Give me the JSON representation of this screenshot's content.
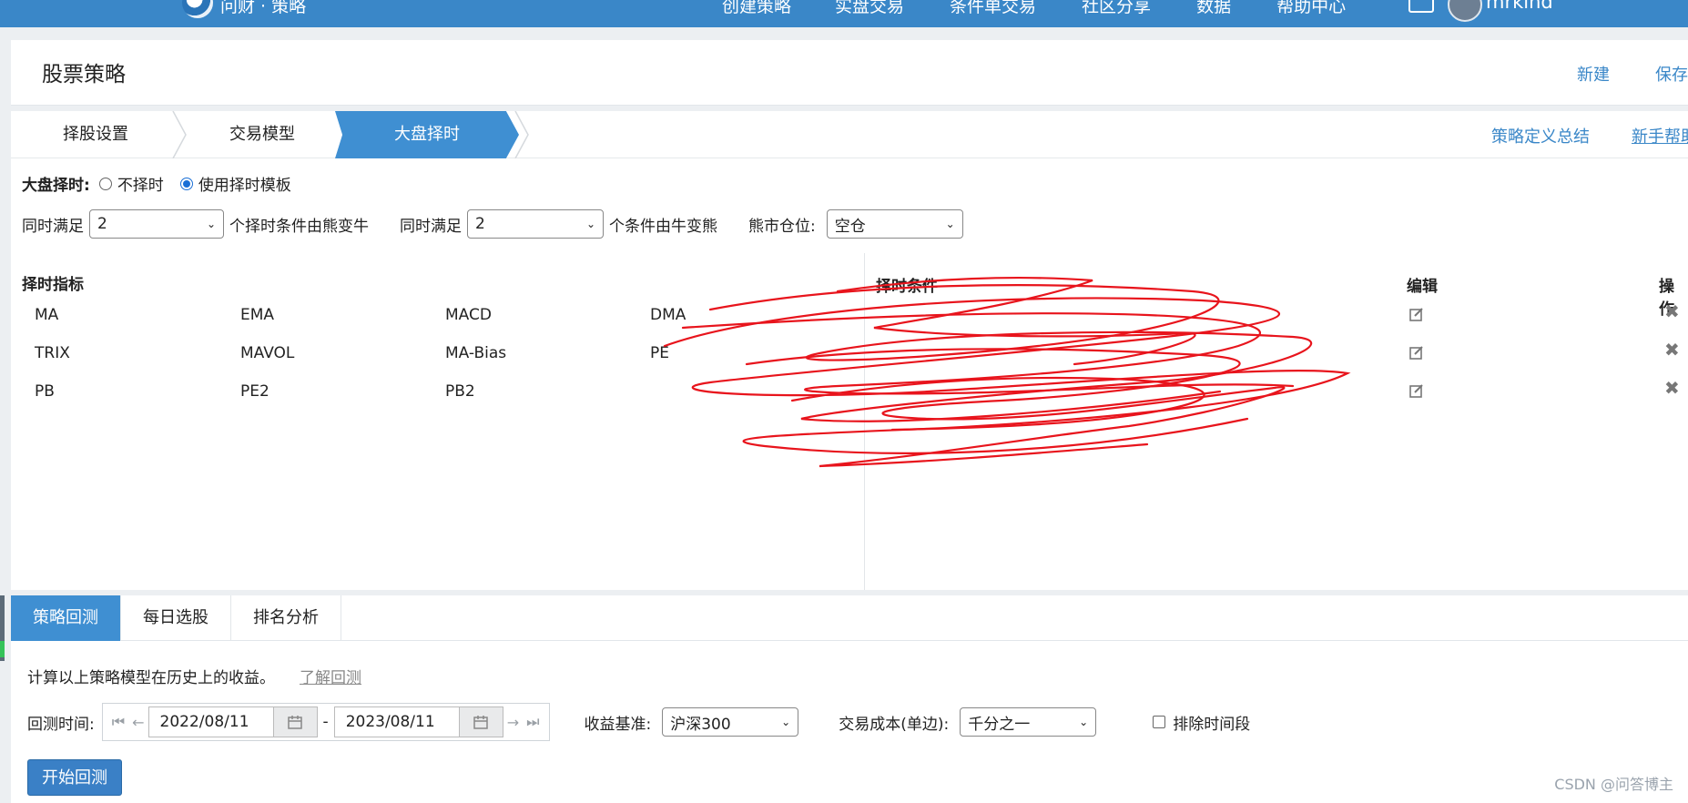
{
  "topnav": {
    "logo_text": "问财 · 策略",
    "items": [
      "创建策略",
      "实盘交易",
      "条件单交易",
      "社区分享",
      "数据",
      "帮助中心"
    ],
    "username": "mrkind"
  },
  "header": {
    "title": "股票策略",
    "new_label": "新建",
    "save_label": "保存"
  },
  "steps": {
    "items": [
      "择股设置",
      "交易模型",
      "大盘择时"
    ],
    "active": "大盘择时",
    "summary_link": "策略定义总结",
    "help_link": "新手帮助"
  },
  "market_timing": {
    "label": "大盘择时:",
    "option_none": "不择时",
    "option_template": "使用择时模板",
    "selected": "使用择时模板"
  },
  "conditions": {
    "prefix1": "同时满足",
    "value1": "2",
    "suffix1": "个择时条件由熊变牛",
    "prefix2": "同时满足",
    "value2": "2",
    "suffix2": "个条件由牛变熊",
    "position_label": "熊市仓位:",
    "position_value": "空仓"
  },
  "indicators": {
    "title": "择时指标",
    "items": [
      "MA",
      "EMA",
      "MACD",
      "DMA",
      "TRIX",
      "MAVOL",
      "MA-Bias",
      "PE",
      "PB",
      "PE2",
      "PB2"
    ]
  },
  "timing_table": {
    "col_condition": "择时条件",
    "col_edit": "编辑",
    "col_action": "操作"
  },
  "bottom": {
    "tabs": [
      "策略回测",
      "每日选股",
      "排名分析"
    ],
    "active_tab": "策略回测",
    "desc": "计算以上策略模型在历史上的收益。",
    "learn_link": "了解回测",
    "bt_time_label": "回测时间:",
    "start_date": "2022/08/11",
    "dash": "-",
    "end_date": "2023/08/11",
    "benchmark_label": "收益基准:",
    "benchmark_value": "沪深300",
    "cost_label": "交易成本(单边):",
    "cost_value": "千分之一",
    "exclude_label": "排除时间段",
    "start_button": "开始回测"
  },
  "watermark": "CSDN @问答博主",
  "colors": {
    "accent": "#3f8fd2",
    "nav": "#3a87c8",
    "link": "#3a87c8",
    "scribble": "#e8141c"
  }
}
